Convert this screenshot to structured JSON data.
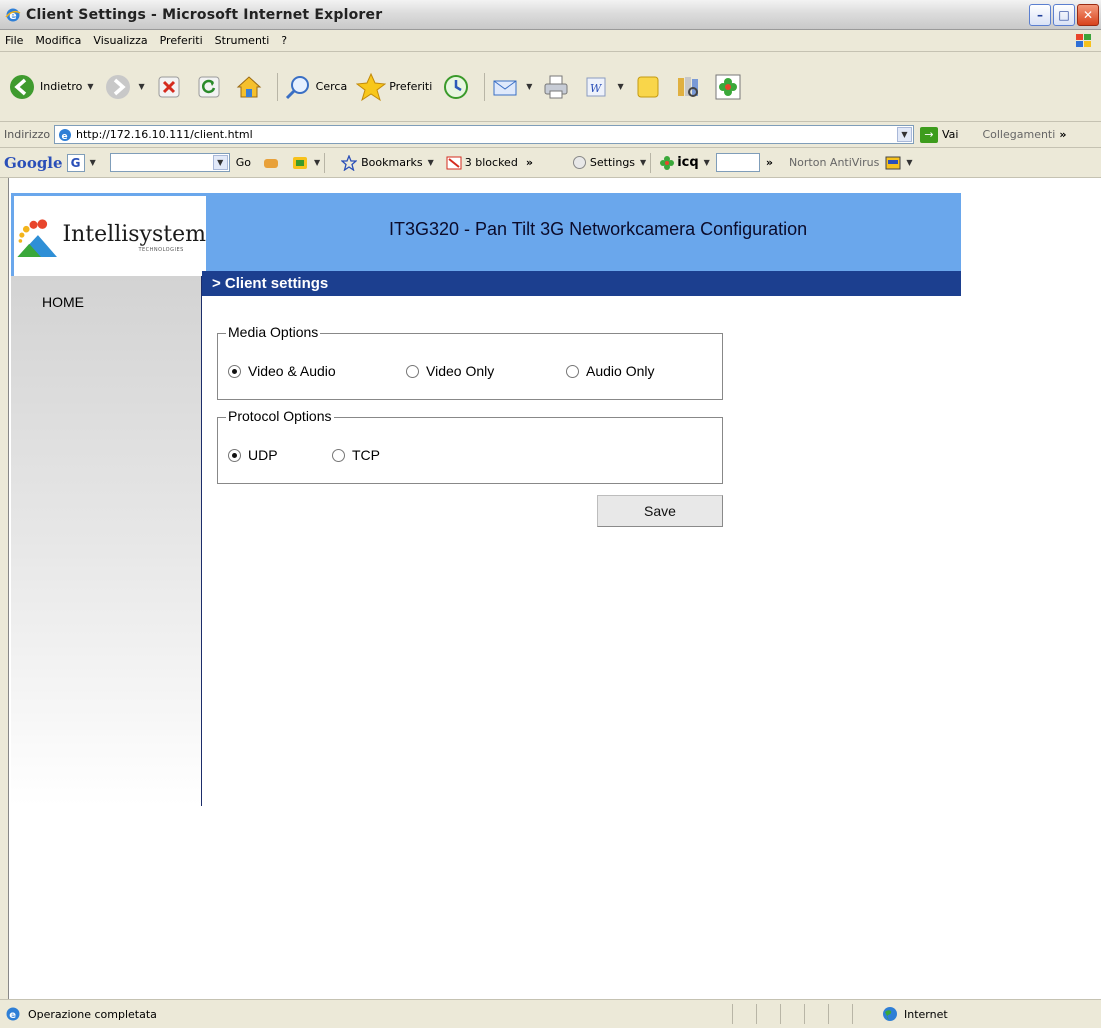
{
  "window": {
    "title": "Client Settings - Microsoft Internet Explorer",
    "min_label": "–",
    "max_label": "□",
    "close_label": "✕"
  },
  "menu": [
    "File",
    "Modifica",
    "Visualizza",
    "Preferiti",
    "Strumenti",
    "?"
  ],
  "toolbar": {
    "back_label": "Indietro",
    "search_label": "Cerca",
    "favorites_label": "Preferiti"
  },
  "address": {
    "label": "Indirizzo",
    "url": "http://172.16.10.111/client.html",
    "go_label": "Vai",
    "links_label": "Collegamenti"
  },
  "google_bar": {
    "logo": "Google",
    "g_label": "G",
    "go_label": "Go",
    "bookmarks_label": "Bookmarks",
    "blocked_label": "3 blocked",
    "settings_label": "Settings",
    "icq_label": "icq",
    "norton_label": "Norton AntiVirus"
  },
  "page": {
    "logo_text": "Intellisystem",
    "logo_sub": "TECHNOLOGIES",
    "banner_title": "IT3G320 - Pan Tilt 3G Networkcamera Configuration",
    "nav_home": "HOME",
    "section_title": "> Client settings",
    "media": {
      "legend": "Media Options",
      "options": [
        "Video & Audio",
        "Video Only",
        "Audio Only"
      ],
      "selected": "Video & Audio"
    },
    "protocol": {
      "legend": "Protocol Options",
      "options": [
        "UDP",
        "TCP"
      ],
      "selected": "UDP"
    },
    "save_label": "Save"
  },
  "status": {
    "text": "Operazione completata",
    "zone": "Internet"
  },
  "colors": {
    "banner": "#6aa7ec",
    "section_header": "#1c3f8f",
    "sidebar_divider": "#1c2d6a"
  }
}
